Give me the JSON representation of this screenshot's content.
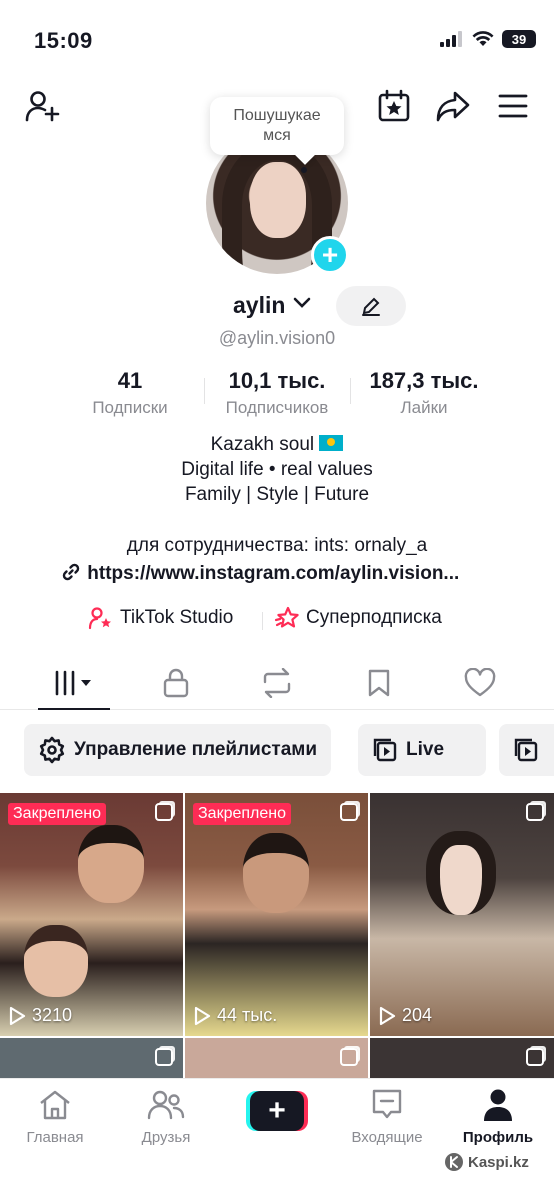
{
  "status_bar": {
    "time": "15:09",
    "battery": "39"
  },
  "header": {
    "add_friend_icon": "person-plus-icon",
    "calendar_icon": "calendar-star-icon",
    "share_icon": "share-arrow-icon",
    "menu_icon": "hamburger-menu-icon"
  },
  "profile": {
    "tooltip": "Пошушукаемся",
    "tooltip_lines": [
      "Пошушукае",
      "мся"
    ],
    "username": "aylin",
    "handle": "@aylin.vision0",
    "stats": [
      {
        "value": "41",
        "label": "Подписки"
      },
      {
        "value": "10,1 тыс.",
        "label": "Подписчиков"
      },
      {
        "value": "187,3 тыс.",
        "label": "Лайки"
      }
    ],
    "bio": [
      "Kazakh soul",
      "Digital life • real values",
      "Family | Style | Future"
    ],
    "contact": "для сотрудничества: ints: ornaly_a",
    "link": "https://www.instagram.com/aylin.vision..."
  },
  "pills": {
    "studio": "TikTok Studio",
    "subscription": "Суперподписка"
  },
  "tabs": [
    "videos-tab",
    "private-tab",
    "reposts-tab",
    "saved-tab",
    "liked-tab"
  ],
  "chips": {
    "playlists": "Управление плейлистами",
    "live": "Live"
  },
  "videos": [
    {
      "pinned": "Закреплено",
      "views": "3210"
    },
    {
      "pinned": "Закреплено",
      "views": "44 тыс."
    },
    {
      "pinned": "",
      "views": "204"
    }
  ],
  "bottom_nav": {
    "home": "Главная",
    "friends": "Друзья",
    "inbox": "Входящие",
    "profile": "Профиль"
  },
  "watermark": "Kaspi.kz",
  "colors": {
    "accent": "#fe2c55",
    "cyan": "#25f4ee",
    "text": "#161823",
    "muted": "#8a8b91"
  }
}
